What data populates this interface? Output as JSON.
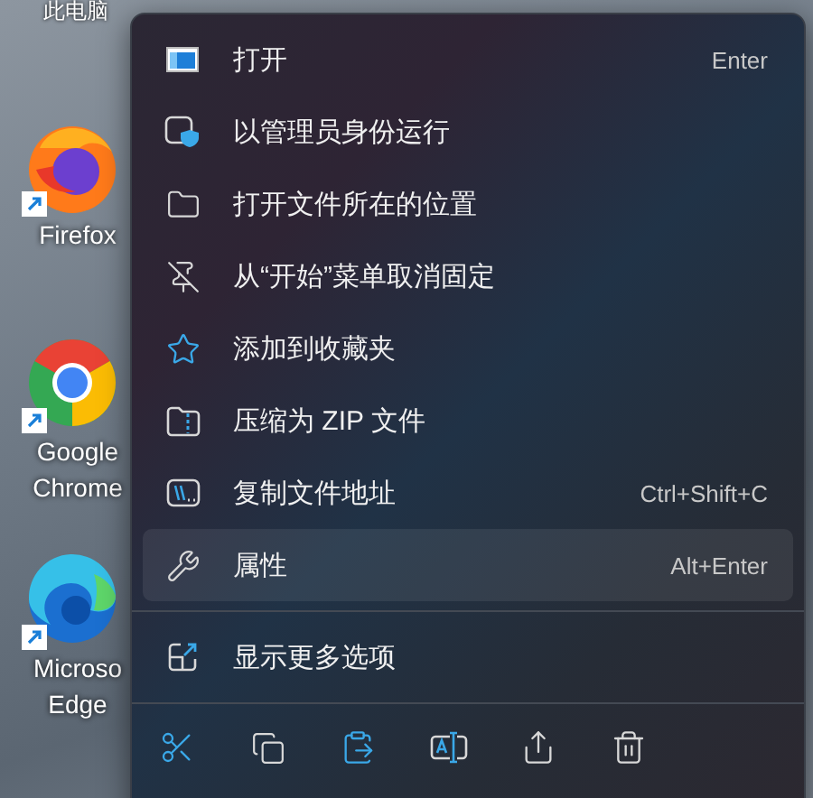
{
  "desktop_top_labels": [
    "此电脑"
  ],
  "desktop_icons": [
    {
      "kind": "firefox",
      "lines": [
        "Firefox"
      ]
    },
    {
      "kind": "chrome",
      "lines": [
        "Google",
        "Chrome"
      ]
    },
    {
      "kind": "edge",
      "lines": [
        "Microso",
        "Edge"
      ]
    }
  ],
  "menu": {
    "items": [
      {
        "kind": "open",
        "label": "打开",
        "shortcut": "Enter",
        "selected": false
      },
      {
        "kind": "admin",
        "label": "以管理员身份运行",
        "selected": false
      },
      {
        "kind": "folder",
        "label": "打开文件所在的位置",
        "selected": false
      },
      {
        "kind": "unpin",
        "label": "从“开始”菜单取消固定",
        "selected": false
      },
      {
        "kind": "star",
        "label": "添加到收藏夹",
        "selected": false
      },
      {
        "kind": "zip",
        "label": "压缩为 ZIP 文件",
        "selected": false
      },
      {
        "kind": "path",
        "label": "复制文件地址",
        "shortcut": "Ctrl+Shift+C",
        "selected": false
      },
      {
        "kind": "wrench",
        "label": "属性",
        "shortcut": "Alt+Enter",
        "selected": true
      }
    ],
    "more": {
      "kind": "more",
      "label": "显示更多选项"
    },
    "toolbar": [
      {
        "kind": "cut"
      },
      {
        "kind": "copy"
      },
      {
        "kind": "paste"
      },
      {
        "kind": "rename"
      },
      {
        "kind": "share"
      },
      {
        "kind": "delete"
      }
    ]
  }
}
